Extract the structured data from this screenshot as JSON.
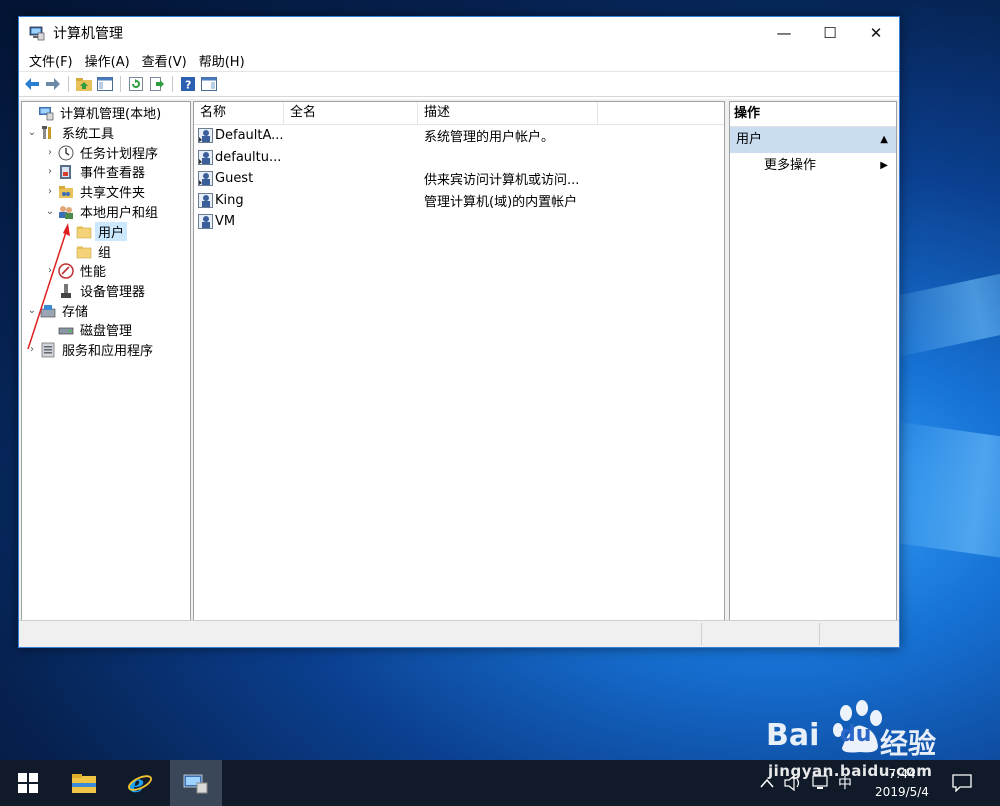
{
  "window": {
    "title": "计算机管理",
    "controls": {
      "minimize": "—",
      "maximize": "☐",
      "close": "✕"
    }
  },
  "menu": [
    "文件(F)",
    "操作(A)",
    "查看(V)",
    "帮助(H)"
  ],
  "tree": [
    {
      "label": "计算机管理(本地)",
      "expander": ""
    },
    {
      "label": "系统工具",
      "expander": "⌄"
    },
    {
      "label": "任务计划程序",
      "expander": "›"
    },
    {
      "label": "事件查看器",
      "expander": "›"
    },
    {
      "label": "共享文件夹",
      "expander": "›"
    },
    {
      "label": "本地用户和组",
      "expander": "⌄"
    },
    {
      "label": "用户",
      "expander": ""
    },
    {
      "label": "组",
      "expander": ""
    },
    {
      "label": "性能",
      "expander": "›"
    },
    {
      "label": "设备管理器",
      "expander": ""
    },
    {
      "label": "存储",
      "expander": "⌄"
    },
    {
      "label": "磁盘管理",
      "expander": ""
    },
    {
      "label": "服务和应用程序",
      "expander": "›"
    }
  ],
  "list": {
    "columns": [
      "名称",
      "全名",
      "描述"
    ],
    "rows": [
      {
        "name": "DefaultA...",
        "fullname": "",
        "desc": "系统管理的用户帐户。"
      },
      {
        "name": "defaultu...",
        "fullname": "",
        "desc": ""
      },
      {
        "name": "Guest",
        "fullname": "",
        "desc": "供来宾访问计算机或访问..."
      },
      {
        "name": "King",
        "fullname": "",
        "desc": "管理计算机(域)的内置帐户"
      },
      {
        "name": "VM",
        "fullname": "",
        "desc": ""
      }
    ]
  },
  "actions": {
    "header": "操作",
    "section": "用户",
    "item": "更多操作"
  },
  "taskbar": {
    "time": "7:44",
    "date": "2019/5/4",
    "ime": "中"
  },
  "watermark": {
    "brand": "Bai",
    "brand2": "du",
    "brand_cn": "经验",
    "url": "jingyan.baidu.com"
  },
  "colors": {
    "selection": "#cce8ff",
    "action_section": "#c9dcf0",
    "annotation_arrow": "#e02020",
    "taskbar": "#101a28"
  }
}
